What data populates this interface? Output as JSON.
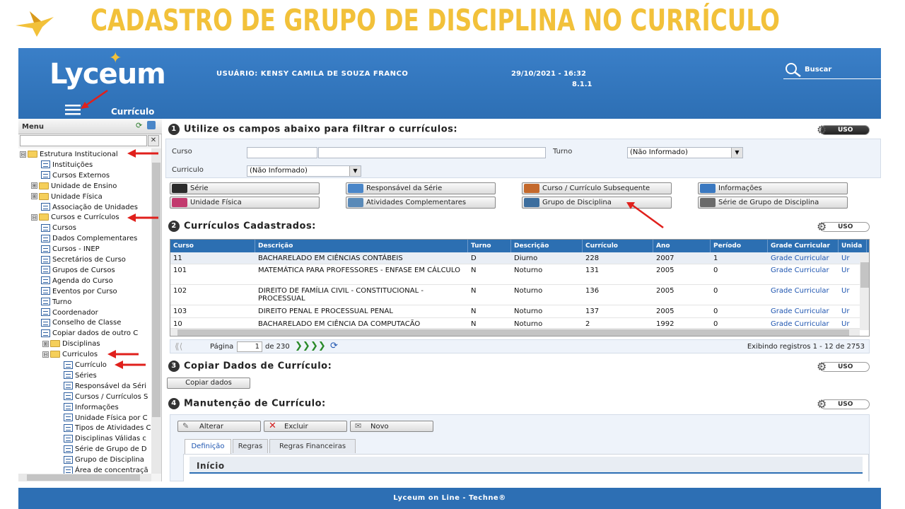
{
  "slide_title": "CADASTRO DE GRUPO DE DISCIPLINA NO CURRÍCULO",
  "app": {
    "logo": "Lyceum",
    "user": "USUÁRIO: KENSY CAMILA DE SOUZA FRANCO",
    "datetime": "29/10/2021 - 16:32",
    "version": "8.1.1",
    "search_label": "Buscar",
    "page_label": "Currículo"
  },
  "sidebar": {
    "title": "Menu",
    "clear": "✕",
    "items": [
      {
        "label": "Estrutura Institucional",
        "type": "folder",
        "expander": "⊟"
      },
      {
        "label": "Instituições",
        "type": "doc"
      },
      {
        "label": "Cursos Externos",
        "type": "doc"
      },
      {
        "label": "Unidade de Ensino",
        "type": "folder",
        "expander": "⊞"
      },
      {
        "label": "Unidade Física",
        "type": "folder",
        "expander": "⊞"
      },
      {
        "label": "Associação de Unidades",
        "type": "doc"
      },
      {
        "label": "Cursos e Currículos",
        "type": "folder",
        "expander": "⊟"
      },
      {
        "label": "Cursos",
        "type": "doc"
      },
      {
        "label": "Dados Complementares",
        "type": "doc"
      },
      {
        "label": "Cursos - INEP",
        "type": "doc"
      },
      {
        "label": "Secretários de Curso",
        "type": "doc"
      },
      {
        "label": "Grupos de Cursos",
        "type": "doc"
      },
      {
        "label": "Agenda do Curso",
        "type": "doc"
      },
      {
        "label": "Eventos por Curso",
        "type": "doc"
      },
      {
        "label": "Turno",
        "type": "doc"
      },
      {
        "label": "Coordenador",
        "type": "doc"
      },
      {
        "label": "Conselho de Classe",
        "type": "doc"
      },
      {
        "label": "Copiar dados de outro C",
        "type": "doc"
      },
      {
        "label": "Disciplinas",
        "type": "folder",
        "expander": "⊞"
      },
      {
        "label": "Curriculos",
        "type": "folder",
        "expander": "⊟"
      },
      {
        "label": "Currículo",
        "type": "doc"
      },
      {
        "label": "Séries",
        "type": "doc"
      },
      {
        "label": "Responsável da Séri",
        "type": "doc"
      },
      {
        "label": "Cursos / Currículos S",
        "type": "doc"
      },
      {
        "label": "Informações",
        "type": "doc"
      },
      {
        "label": "Unidade Física por C",
        "type": "doc"
      },
      {
        "label": "Tipos de Atividades C",
        "type": "doc"
      },
      {
        "label": "Disciplinas Válidas c",
        "type": "doc"
      },
      {
        "label": "Série de Grupo de D",
        "type": "doc"
      },
      {
        "label": "Grupo de Disciplina",
        "type": "doc"
      },
      {
        "label": "Área de concentraçã",
        "type": "doc"
      }
    ]
  },
  "section1": {
    "num": "1",
    "title": "Utilize os campos abaixo para filtrar o currículos:",
    "uso": "USO",
    "curso_label": "Curso",
    "curso_code": "",
    "curso_name": "",
    "turno_label": "Turno",
    "turno_value": "(Não Informado)",
    "curriculo_label": "Curriculo",
    "curriculo_value": "(Não Informado)",
    "dropdown_arrow": "▼"
  },
  "nav_buttons": [
    {
      "label": "Série",
      "color": "#2b2b2b"
    },
    {
      "label": "Responsável da Série",
      "color": "#4a86c8"
    },
    {
      "label": "Curso / Currículo Subsequente",
      "color": "#c4692c"
    },
    {
      "label": "Informações",
      "color": "#3a78c0"
    },
    {
      "label": "Unidade Física",
      "color": "#c23a6e"
    },
    {
      "label": "Atividades Complementares",
      "color": "#5a8ab8"
    },
    {
      "label": "Grupo de Disciplina",
      "color": "#3d6e9e"
    },
    {
      "label": "Série de Grupo de Disciplina",
      "color": "#6a6a6a"
    }
  ],
  "section2": {
    "num": "2",
    "title": "Currículos Cadastrados:",
    "uso": "USO",
    "columns": [
      "Curso",
      "Descrição",
      "Turno",
      "Descrição",
      "Currículo",
      "Ano",
      "Período",
      "Grade Curricular",
      "Unida"
    ],
    "rows": [
      {
        "curso": "11",
        "descricao": "BACHARELADO EM CIÊNCIAS CONTÁBEIS",
        "turno": "D",
        "turno_desc": "Diurno",
        "curriculo": "228",
        "ano": "2007",
        "periodo": "1",
        "grade": "Grade Curricular",
        "unidade": "Ur"
      },
      {
        "curso": "101",
        "descricao": "MATEMÁTICA PARA PROFESSORES - ENFASE EM CÁLCULO",
        "turno": "N",
        "turno_desc": "Noturno",
        "curriculo": "131",
        "ano": "2005",
        "periodo": "0",
        "grade": "Grade Curricular",
        "unidade": "Ur"
      },
      {
        "curso": "102",
        "descricao": "DIREITO DE FAMÍLIA CIVIL - CONSTITUCIONAL - PROCESSUAL",
        "turno": "N",
        "turno_desc": "Noturno",
        "curriculo": "136",
        "ano": "2005",
        "periodo": "0",
        "grade": "Grade Curricular",
        "unidade": "Ur"
      },
      {
        "curso": "103",
        "descricao": "DIREITO PENAL E PROCESSUAL PENAL",
        "turno": "N",
        "turno_desc": "Noturno",
        "curriculo": "137",
        "ano": "2005",
        "periodo": "0",
        "grade": "Grade Curricular",
        "unidade": "Ur"
      },
      {
        "curso": "10",
        "descricao": "BACHARELADO EM CIÊNCIA DA COMPUTACÃO",
        "turno": "N",
        "turno_desc": "Noturno",
        "curriculo": "2",
        "ano": "1992",
        "periodo": "0",
        "grade": "Grade Curricular",
        "unidade": "Ur"
      }
    ],
    "pager": {
      "label": "Página",
      "current": "1",
      "of": "de 230",
      "summary": "Exibindo registros 1 - 12 de 2753"
    }
  },
  "section3": {
    "num": "3",
    "title": "Copiar Dados de Currículo:",
    "uso": "USO",
    "copy_button": "Copiar dados"
  },
  "section4": {
    "num": "4",
    "title": "Manutenção de Currículo:",
    "uso": "USO",
    "alterar": "Alterar",
    "excluir": "Excluir",
    "novo": "Novo",
    "tabs": [
      "Definição",
      "Regras",
      "Regras Financeiras"
    ],
    "panel_title": "Início"
  },
  "footer": "Lyceum on Line - Techne®",
  "colors": {
    "title_gold": "#f2c13a",
    "header_blue": "#2d6fb4",
    "grid_header": "#2c6fb2",
    "link_blue": "#1e55b0",
    "annotation_red": "#e0201c"
  }
}
